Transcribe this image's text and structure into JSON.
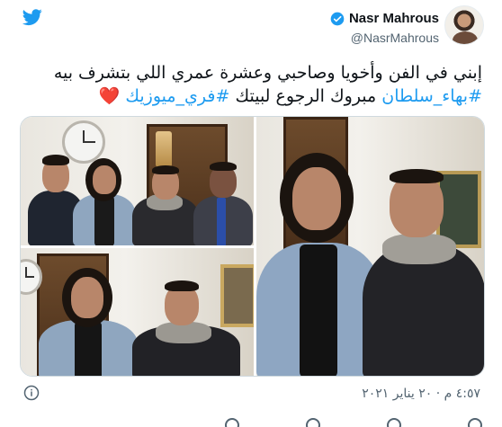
{
  "header": {
    "display_name": "Nasr Mahrous",
    "handle": "@NasrMahrous",
    "verified": true,
    "logo": "twitter-bird-icon",
    "accent_color": "#1d9bf0"
  },
  "tweet": {
    "line1": "إبني في الفن وأخويا وصاحبي وعشرة عمري اللي بتشرف بيه",
    "hashtag1": "#بهاء_سلطان",
    "middle_text": " مبروك الرجوع لبيتك ",
    "hashtag2": "#فري_ميوزيك",
    "heart": "❤️"
  },
  "media": {
    "photo_count": 3,
    "photos": [
      "group-photo-four-men",
      "two-men-photo-left",
      "two-men-photo-right"
    ]
  },
  "footer": {
    "timestamp": "٤:٥٧ م · ٢٠ يناير ٢٠٢١",
    "info_icon": "info-icon"
  },
  "colors": {
    "text": "#0f1419",
    "secondary": "#536471",
    "hashtag": "#1d9bf0",
    "heart": "#e0245e",
    "border": "#cfd9de"
  }
}
